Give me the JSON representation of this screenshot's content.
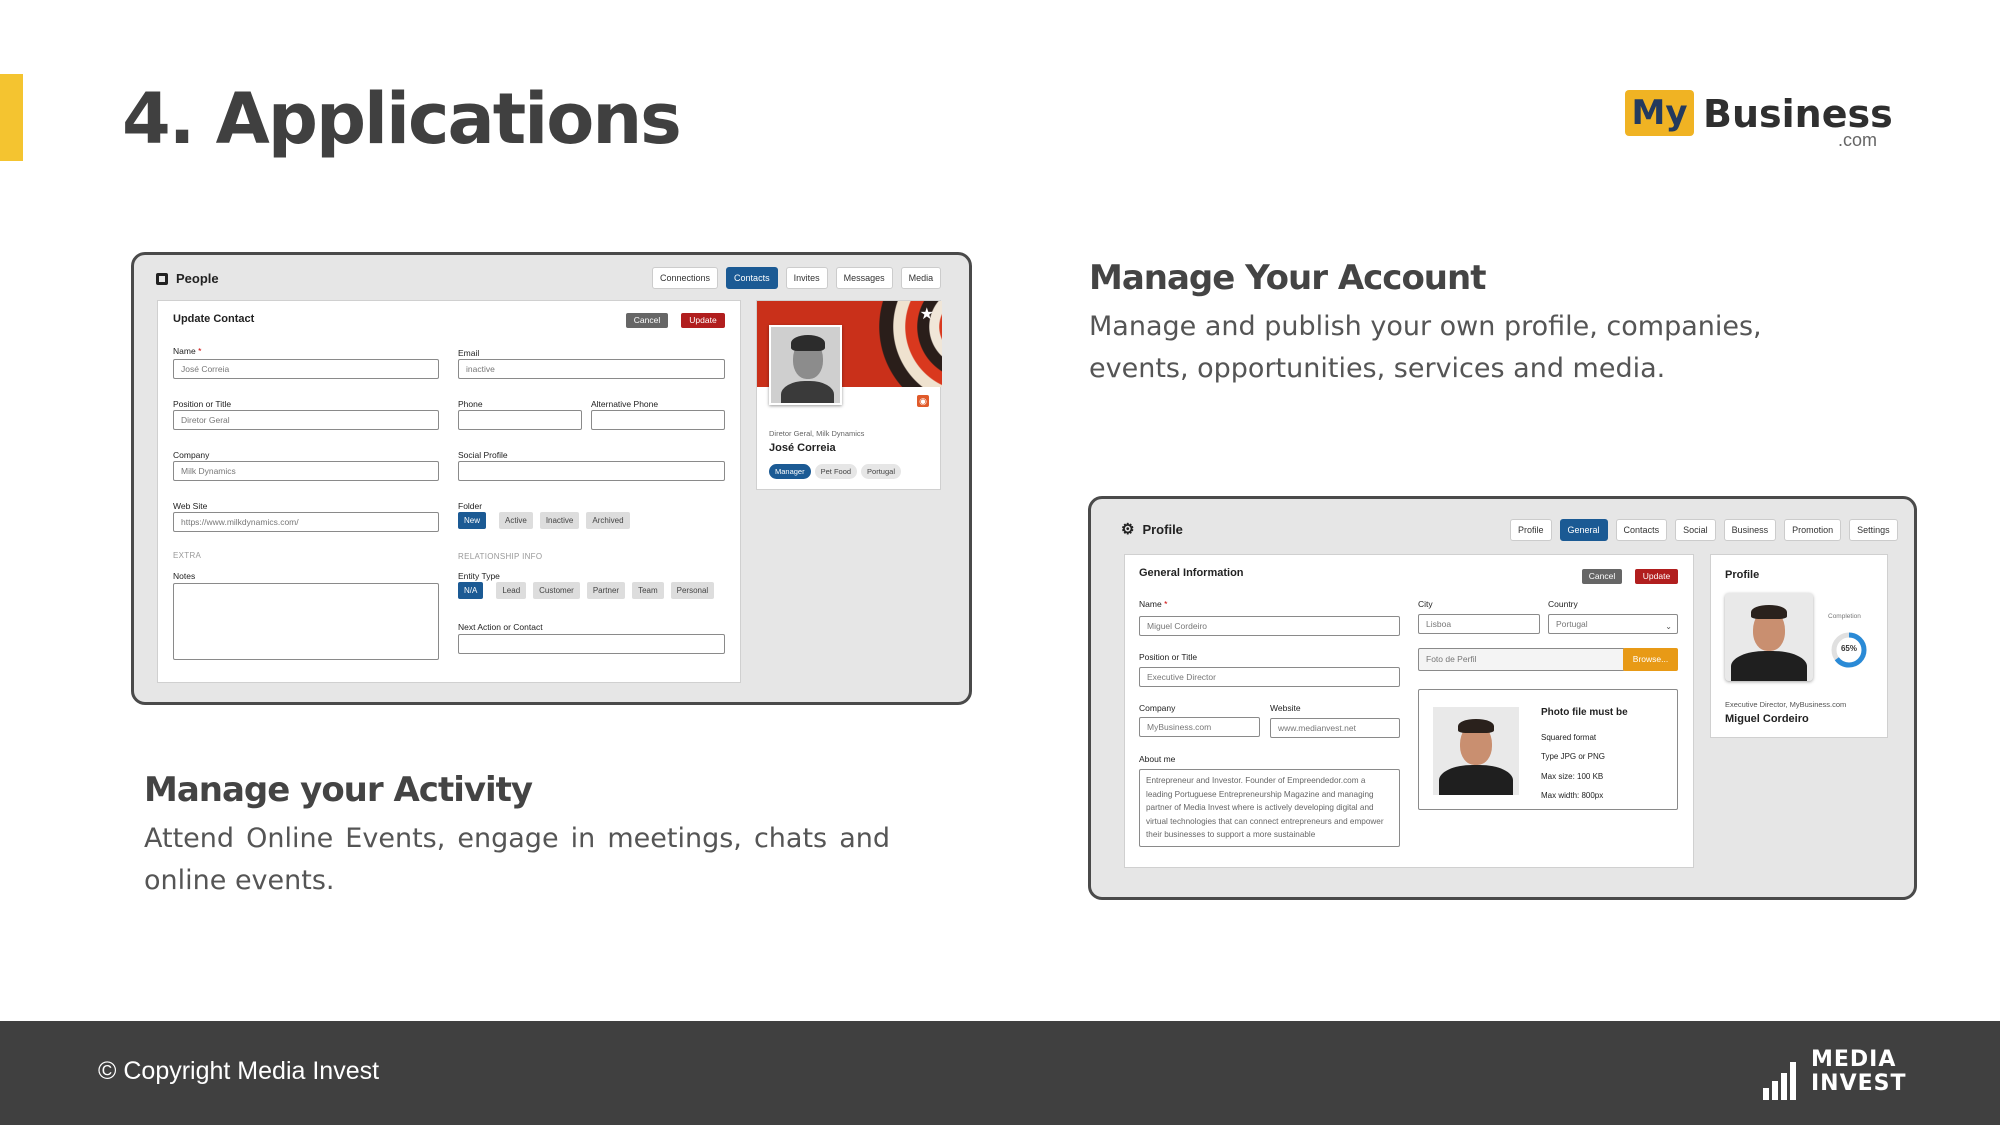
{
  "slide": {
    "title": "4. Applications",
    "brand": {
      "my": "My",
      "business": "Business",
      "com": ".com"
    },
    "footer": {
      "copyright": "© Copyright Media Invest",
      "logo_line1": "MEDIA",
      "logo_line2": "INVEST"
    },
    "sections": {
      "activity": {
        "title": "Manage your Activity",
        "body": "Attend Online Events, engage in meetings, chats and online events."
      },
      "account": {
        "title": "Manage Your Account",
        "body": "Manage and publish your own profile, companies, events, opportunities, services and media."
      }
    }
  },
  "people_window": {
    "title": "People",
    "tabs": [
      "Connections",
      "Contacts",
      "Invites",
      "Messages",
      "Media"
    ],
    "active_tab": "Contacts",
    "form": {
      "heading": "Update Contact",
      "cancel": "Cancel",
      "update": "Update",
      "name_label": "Name",
      "name_value": "José Correia",
      "email_label": "Email",
      "email_value": "inactive",
      "position_label": "Position or Title",
      "position_value": "Diretor Geral",
      "phone_label": "Phone",
      "alt_phone_label": "Alternative Phone",
      "company_label": "Company",
      "company_value": "Milk Dynamics",
      "social_label": "Social Profile",
      "website_label": "Web Site",
      "website_value": "https://www.milkdynamics.com/",
      "folder_label": "Folder",
      "folders": [
        "New",
        "Active",
        "Inactive",
        "Archived"
      ],
      "extra_label": "EXTRA",
      "notes_label": "Notes",
      "relationship_label": "RELATIONSHIP INFO",
      "entity_label": "Entity Type",
      "entity_types": [
        "N/A",
        "Lead",
        "Customer",
        "Partner",
        "Team",
        "Personal"
      ],
      "next_action_label": "Next Action or Contact"
    },
    "profile_card": {
      "subtitle": "Diretor Geral, Milk Dynamics",
      "name": "José Correia",
      "tags": [
        "Manager",
        "Pet Food",
        "Portugal"
      ]
    }
  },
  "profile_window": {
    "title": "Profile",
    "tabs": [
      "Profile",
      "General",
      "Contacts",
      "Social",
      "Business",
      "Promotion",
      "Settings"
    ],
    "active_tab": "General",
    "form": {
      "heading": "General Information",
      "cancel": "Cancel",
      "update": "Update",
      "name_label": "Name",
      "name_value": "Miguel Cordeiro",
      "position_label": "Position or Title",
      "position_value": "Executive Director",
      "company_label": "Company",
      "company_value": "MyBusiness.com",
      "website_label": "Website",
      "website_value": "www.medianvest.net",
      "about_label": "About me",
      "about_value": "Entrepreneur and Investor. Founder of Empreendedor.com a leading Portuguese Entrepreneurship Magazine and managing partner of Media Invest where is actively developing digital and virtual technologies that can connect entrepreneurs and empower their businesses to support a more sustainable",
      "city_label": "City",
      "city_value": "Lisboa",
      "country_label": "Country",
      "country_value": "Portugal",
      "photo_placeholder": "Foto de Perfil",
      "browse": "Browse...",
      "photo_rules_title": "Photo file must be",
      "photo_rules": [
        "Squared format",
        "Type JPG or PNG",
        "Max size: 100 KB",
        "Max width: 800px"
      ]
    },
    "profile_card": {
      "heading": "Profile",
      "completion_label": "Completion",
      "completion_value": "65%",
      "completion": 0.65,
      "subtitle": "Executive Director, MyBusiness.com",
      "name": "Miguel Cordeiro"
    }
  },
  "colors": {
    "accent_yellow": "#f4c430",
    "active_blue": "#1b5a94",
    "update_red": "#b11e1e",
    "browse_orange": "#e89a16"
  }
}
